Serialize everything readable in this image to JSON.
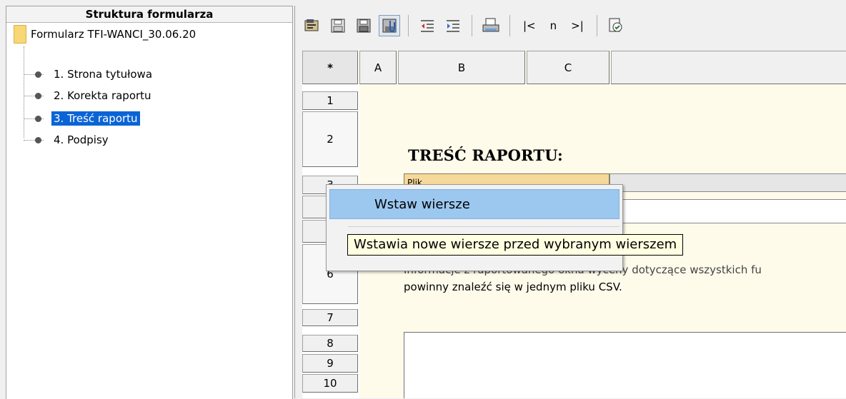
{
  "tree": {
    "title": "Struktura formularza",
    "root_label": "Formularz TFI-WANCI_30.06.20",
    "items": [
      {
        "label": "1. Strona tytułowa"
      },
      {
        "label": "2. Korekta raportu"
      },
      {
        "label": "3. Treść raportu"
      },
      {
        "label": "4. Podpisy"
      }
    ],
    "selected_index": 2
  },
  "toolbar": {
    "first_label": "|<",
    "n_label": "n",
    "last_label": ">|"
  },
  "grid": {
    "corner": "*",
    "columns": [
      "A",
      "B",
      "C"
    ],
    "rows": [
      "1",
      "2",
      "3",
      "4",
      "5",
      "6",
      "7",
      "8",
      "9",
      "10"
    ],
    "sheet_title": "TREŚĆ RAPORTU:",
    "row3_cell_b": "Plik",
    "info_line_1": "Informacje z raportowanego okna wyceny dotyczące wszystkich fu",
    "info_line_2": "powinny znaleźć się w jednym pliku CSV."
  },
  "context_menu": {
    "item": "Wstaw wiersze"
  },
  "tooltip": "Wstawia nowe wiersze przed wybranym wierszem",
  "colors": {
    "selection": "#0a64d6",
    "sheet_bg": "#fffbeb",
    "menu_highlight": "#9cc8f0",
    "tooltip_bg": "#ffffe1"
  }
}
